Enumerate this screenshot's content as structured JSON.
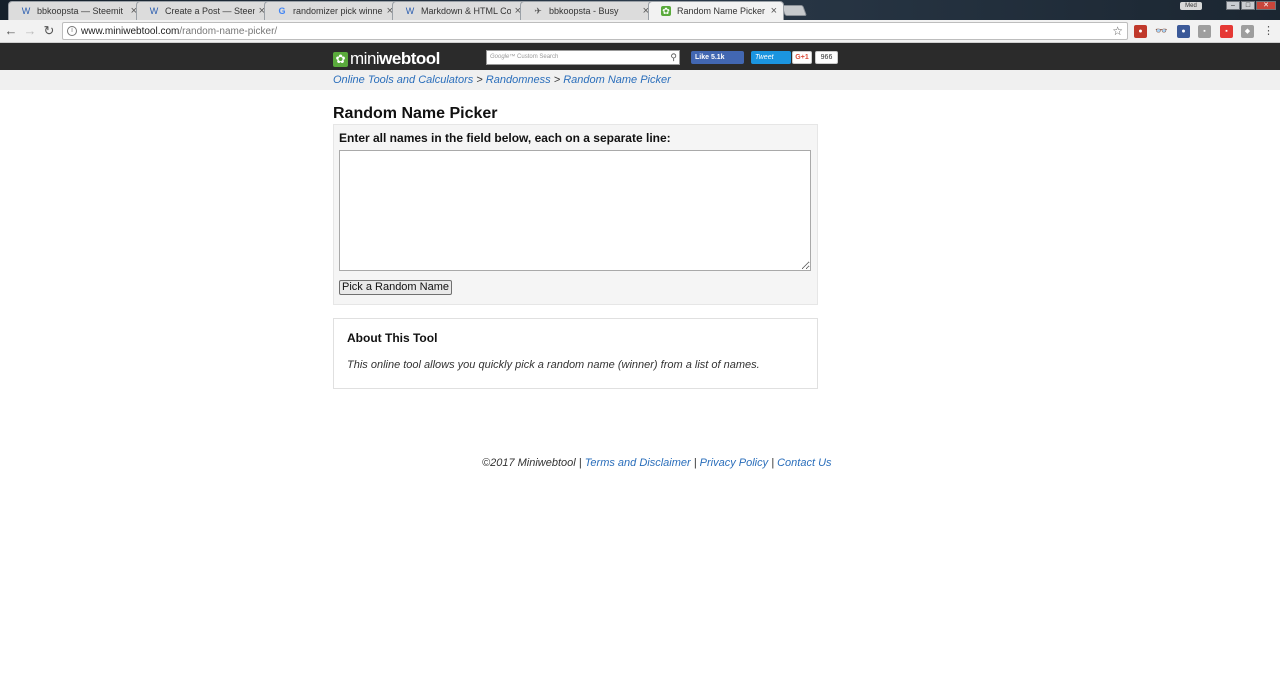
{
  "browser": {
    "tabs": [
      {
        "title": "bbkoopsta — Steemit",
        "icon": "steemit-icon"
      },
      {
        "title": "Create a Post — Steemit",
        "icon": "steemit-icon"
      },
      {
        "title": "randomizer pick winner",
        "icon": "google-icon"
      },
      {
        "title": "Markdown & HTML Cod",
        "icon": "steemit-icon"
      },
      {
        "title": "bbkoopsta - Busy",
        "icon": "busy-icon"
      },
      {
        "title": "Random Name Picker - C",
        "icon": "miniwebtool-icon",
        "active": true
      }
    ],
    "profile_label": "Med",
    "url_host": "www.miniwebtool.com",
    "url_path": "/random-name-picker/"
  },
  "header": {
    "logo_mini": "mini",
    "logo_web": "webtool",
    "search_placeholder": "Custom Search",
    "search_brand": "Google™",
    "fb_like": "Like 5.1k",
    "tweet": "Tweet",
    "gplus": "G+1",
    "gplus_count": "966"
  },
  "breadcrumb": {
    "items": [
      "Online Tools and Calculators",
      "Randomness",
      "Random Name Picker"
    ],
    "separator": ">"
  },
  "main": {
    "title": "Random Name Picker",
    "input_label": "Enter all names in the field below, each on a separate line:",
    "names_value": "",
    "submit_label": "Pick a Random Name"
  },
  "about": {
    "heading": "About This Tool",
    "text": "This online tool allows you quickly pick a random name (winner) from a list of names."
  },
  "footer": {
    "copyright": "©2017 Miniwebtool",
    "links": [
      "Terms and Disclaimer",
      "Privacy Policy",
      "Contact Us"
    ],
    "separator": "|"
  },
  "colors": {
    "link": "#2a6ebb",
    "site_bar": "#2b2b2b",
    "logo_green": "#5aaa3c",
    "facebook": "#4267b2",
    "twitter": "#1b95e0"
  }
}
